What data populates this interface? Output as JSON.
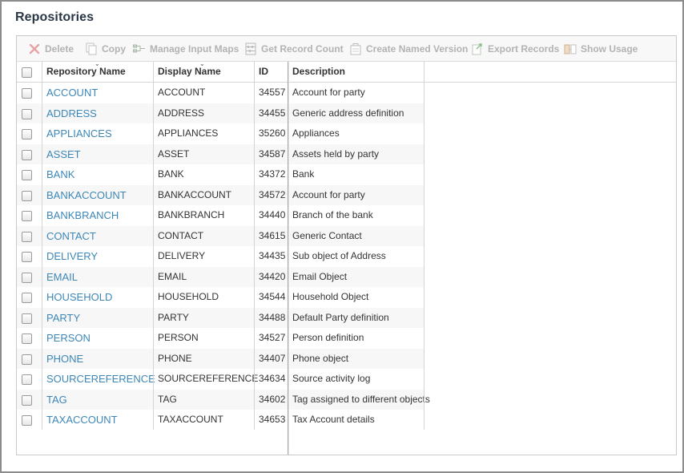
{
  "page": {
    "title": "Repositories"
  },
  "toolbar": {
    "delete": "Delete",
    "copy": "Copy",
    "manage_input_maps": "Manage Input Maps",
    "get_record_count": "Get Record Count",
    "create_named_version": "Create Named Version",
    "export_records": "Export Records",
    "show_usage": "Show Usage"
  },
  "table": {
    "columns": {
      "repository_name": "Repository Name",
      "display_name": "Display Name",
      "id": "ID",
      "description": "Description"
    },
    "rows": [
      {
        "name": "ACCOUNT",
        "display": "ACCOUNT",
        "id": "34557",
        "desc": "Account for party"
      },
      {
        "name": "ADDRESS",
        "display": "ADDRESS",
        "id": "34455",
        "desc": "Generic address definition"
      },
      {
        "name": "APPLIANCES",
        "display": "APPLIANCES",
        "id": "35260",
        "desc": "Appliances"
      },
      {
        "name": "ASSET",
        "display": "ASSET",
        "id": "34587",
        "desc": "Assets held by party"
      },
      {
        "name": "BANK",
        "display": "BANK",
        "id": "34372",
        "desc": "Bank"
      },
      {
        "name": "BANKACCOUNT",
        "display": "BANKACCOUNT",
        "id": "34572",
        "desc": "Account for party"
      },
      {
        "name": "BANKBRANCH",
        "display": "BANKBRANCH",
        "id": "34440",
        "desc": "Branch of the bank"
      },
      {
        "name": "CONTACT",
        "display": "CONTACT",
        "id": "34615",
        "desc": "Generic Contact"
      },
      {
        "name": "DELIVERY",
        "display": "DELIVERY",
        "id": "34435",
        "desc": "Sub object of Address"
      },
      {
        "name": "EMAIL",
        "display": "EMAIL",
        "id": "34420",
        "desc": "Email Object"
      },
      {
        "name": "HOUSEHOLD",
        "display": "HOUSEHOLD",
        "id": "34544",
        "desc": "Household Object"
      },
      {
        "name": "PARTY",
        "display": "PARTY",
        "id": "34488",
        "desc": "Default Party definition"
      },
      {
        "name": "PERSON",
        "display": "PERSON",
        "id": "34527",
        "desc": "Person definition"
      },
      {
        "name": "PHONE",
        "display": "PHONE",
        "id": "34407",
        "desc": "Phone object"
      },
      {
        "name": "SOURCEREFERENCE",
        "display": "SOURCEREFERENCE",
        "id": "34634",
        "desc": "Source activity log"
      },
      {
        "name": "TAG",
        "display": "TAG",
        "id": "34602",
        "desc": "Tag assigned to different objects"
      },
      {
        "name": "TAXACCOUNT",
        "display": "TAXACCOUNT",
        "id": "34653",
        "desc": "Tax Account details"
      }
    ]
  },
  "colors": {
    "link": "#3d87b8",
    "title": "#2a3746",
    "toolbar_disabled_text": "#b3b3b3",
    "row_alt": "#f7f7f7"
  },
  "icons": {
    "delete": "x-icon",
    "copy": "copy-icon",
    "manage_input_maps": "input-map-icon",
    "get_record_count": "abacus-icon",
    "create_named_version": "version-icon",
    "export_records": "export-icon",
    "show_usage": "usage-icon"
  }
}
